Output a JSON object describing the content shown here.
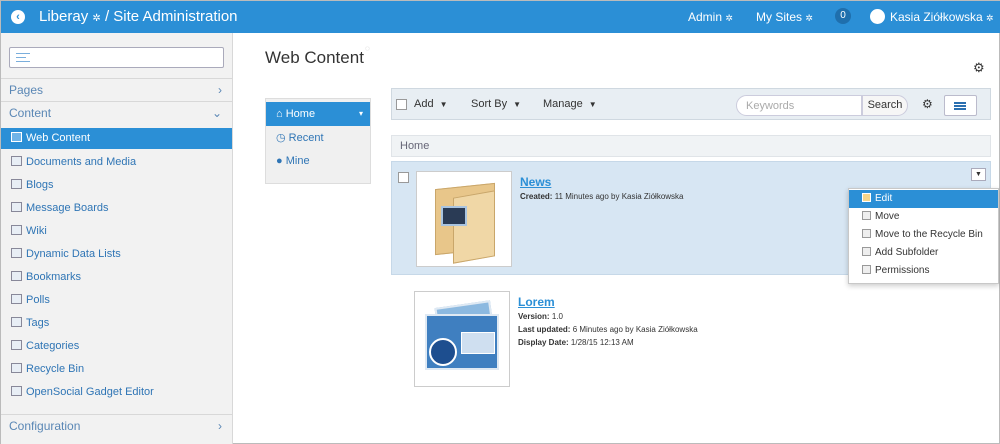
{
  "topbar": {
    "brand": "Liberay",
    "separator": "/",
    "section": "Site Administration",
    "admin": "Admin",
    "my_sites": "My Sites",
    "notifications": "0",
    "user": "Kasia Ziółkowska",
    "color": "#2b8fd6"
  },
  "sidebar": {
    "pages": "Pages",
    "content": "Content",
    "configuration": "Configuration",
    "items": [
      {
        "label": "Web Content",
        "icon": "web-content-icon",
        "active": true
      },
      {
        "label": "Documents and Media",
        "icon": "documents-icon"
      },
      {
        "label": "Blogs",
        "icon": "blogs-icon"
      },
      {
        "label": "Message Boards",
        "icon": "message-boards-icon"
      },
      {
        "label": "Wiki",
        "icon": "wiki-icon"
      },
      {
        "label": "Dynamic Data Lists",
        "icon": "data-lists-icon"
      },
      {
        "label": "Bookmarks",
        "icon": "bookmarks-icon"
      },
      {
        "label": "Polls",
        "icon": "polls-icon"
      },
      {
        "label": "Tags",
        "icon": "tags-icon"
      },
      {
        "label": "Categories",
        "icon": "categories-icon"
      },
      {
        "label": "Recycle Bin",
        "icon": "recycle-bin-icon"
      },
      {
        "label": "OpenSocial Gadget Editor",
        "icon": "gadget-editor-icon"
      }
    ]
  },
  "main": {
    "title": "Web Content",
    "leftnav": [
      {
        "label": "Home",
        "icon": "home-icon"
      },
      {
        "label": "Recent",
        "icon": "clock-icon"
      },
      {
        "label": "Mine",
        "icon": "user-icon"
      }
    ],
    "toolbar": {
      "add": "Add",
      "sort_by": "Sort By",
      "manage": "Manage",
      "keywords_placeholder": "Keywords",
      "search": "Search"
    },
    "breadcrumb": "Home",
    "folder": {
      "title": "News",
      "created_label": "Created:",
      "created_value": "11 Minutes ago by Kasia Ziółkowska"
    },
    "menu": [
      {
        "label": "Edit",
        "icon": "edit-icon"
      },
      {
        "label": "Move",
        "icon": "move-icon"
      },
      {
        "label": "Move to the Recycle Bin",
        "icon": "recycle-bin-icon"
      },
      {
        "label": "Add Subfolder",
        "icon": "add-folder-icon"
      },
      {
        "label": "Permissions",
        "icon": "permissions-icon"
      }
    ],
    "article": {
      "title": "Lorem",
      "version_label": "Version:",
      "version_value": "1.0",
      "updated_label": "Last updated:",
      "updated_value": "6 Minutes ago by Kasia Ziółkowska",
      "display_label": "Display Date:",
      "display_value": "1/28/15 12:13 AM"
    }
  }
}
